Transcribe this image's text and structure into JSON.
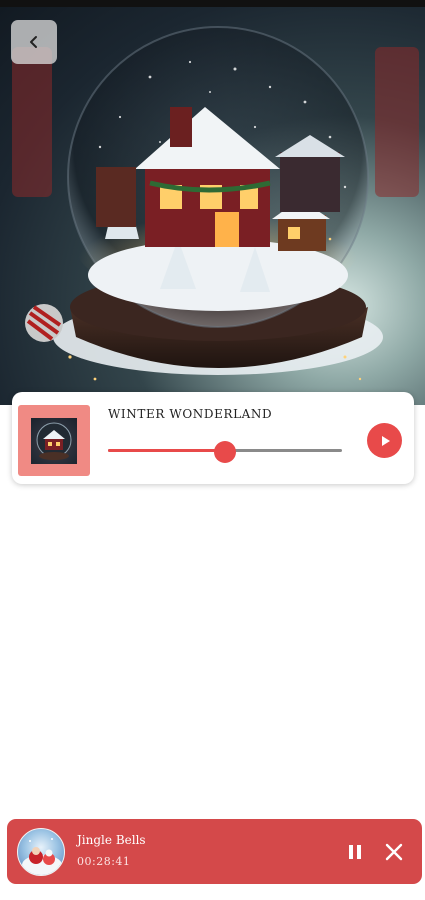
{
  "header": {
    "back_icon": "chevron-left-icon"
  },
  "now_playing_card": {
    "title": "WINTER WONDERLAND",
    "progress": 0.5,
    "play_icon": "play-icon",
    "accent_color": "#e84a4a",
    "thumb_frame_color": "#f08a84"
  },
  "mini_player": {
    "title": "Jingle Bells",
    "time": "00:28:41",
    "pause_icon": "pause-icon",
    "close_icon": "close-icon",
    "background_color": "#d4494a"
  }
}
